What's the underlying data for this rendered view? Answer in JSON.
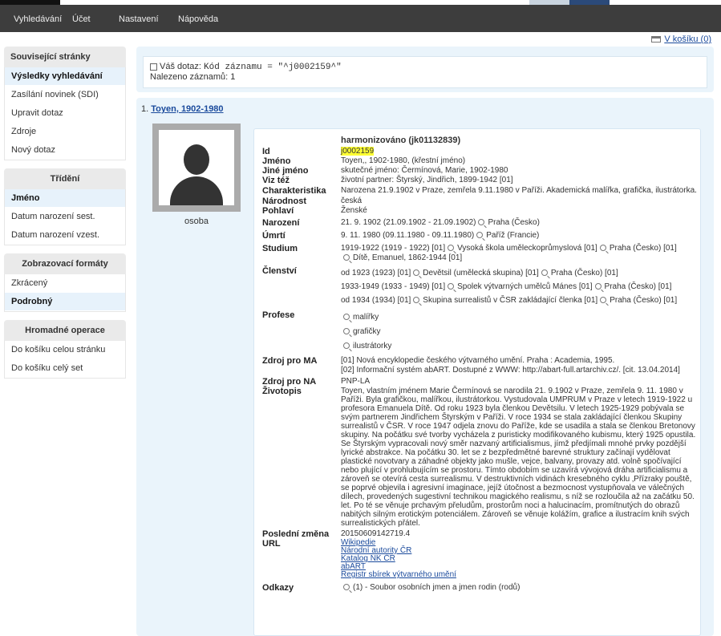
{
  "nav": {
    "items": [
      "Vyhledávání",
      "Účet",
      "Nastavení",
      "Nápověda"
    ]
  },
  "cart": {
    "label": "V košíku (0)"
  },
  "sidebar": {
    "related_title": "Související stránky",
    "related_items": [
      "Výsledky vyhledávání",
      "Zasílání novinek (SDI)",
      "Upravit dotaz",
      "Zdroje",
      "Nový dotaz"
    ],
    "sort_title": "Třídění",
    "sort_items": [
      "Jméno",
      "Datum narození sest.",
      "Datum narození vzest."
    ],
    "format_title": "Zobrazovací formáty",
    "format_items": [
      "Zkrácený",
      "Podrobný"
    ],
    "bulk_title": "Hromadné operace",
    "bulk_items": [
      "Do košíku celou stránku",
      "Do košíku celý set"
    ]
  },
  "query": {
    "prefix": "Váš dotaz:",
    "code": "Kód záznamu = \"^j0002159^\"",
    "count_text": "Nalezeno záznamů: 1"
  },
  "result": {
    "index": "1.",
    "title": "Toyen, 1902-1980",
    "photo_label": "osoba",
    "harmonized": "harmonizováno (jk01132839)",
    "labels": {
      "id": "Id",
      "name": "Jméno",
      "other_name": "Jiné jméno",
      "see_also": "Viz též",
      "characteristics": "Charakteristika",
      "nationality": "Národnost",
      "gender": "Pohlaví",
      "birth": "Narození",
      "death": "Úmrtí",
      "study": "Studium",
      "membership": "Členství",
      "profession": "Profese",
      "source_ma": "Zdroj pro MA",
      "source_na": "Zdroj pro NA",
      "bio": "Životopis",
      "last_change": "Poslední změna",
      "url": "URL",
      "links": "Odkazy"
    },
    "id": "j0002159",
    "name": "Toyen,, 1902-1980, (křestní jméno)",
    "other_name": "skutečné jméno: Čermínová, Marie, 1902-1980",
    "see_also": "životní partner: Štyrský, Jindřich, 1899-1942 [01]",
    "characteristics": "Narozena 21.9.1902 v Praze, zemřela 9.11.1980 v Paříži. Akademická malířka, grafička, ilustrátorka.",
    "nationality": "česká",
    "gender": "Ženské",
    "birth_a": "21. 9. 1902 (21.09.1902 - 21.09.1902)",
    "birth_b": "Praha (Česko)",
    "death_a": "9. 11. 1980 (09.11.1980 - 09.11.1980)",
    "death_b": "Paříž (Francie)",
    "study_1a": "1919-1922 (1919 - 1922) [01]",
    "study_1b": "Vysoká škola uměleckoprůmyslová [01]",
    "study_1c": "Praha (Česko) [01]",
    "study_2": "Dítě, Emanuel, 1862-1944 [01]",
    "member_1a": "od 1923 (1923) [01]",
    "member_1b": "Devětsil (umělecká skupina) [01]",
    "member_1c": "Praha (Česko) [01]",
    "member_2a": "1933-1949 (1933 - 1949) [01]",
    "member_2b": "Spolek výtvarných umělců Mánes [01]",
    "member_2c": "Praha (Česko) [01]",
    "member_3a": "od 1934 (1934) [01]",
    "member_3b": "Skupina surrealistů v ČSR zakládající členka [01]",
    "member_3c": "Praha (Česko) [01]",
    "professions": [
      "malířky",
      "grafičky",
      "ilustrátorky"
    ],
    "source_ma_1": "[01] Nová encyklopedie českého výtvarného umění. Praha : Academia, 1995.",
    "source_ma_2": "[02] Informační systém abART. Dostupné z WWW: http://abart-full.artarchiv.cz/. [cit. 13.04.2014]",
    "source_na": "PNP-LA",
    "bio": "Toyen, vlastním jménem Marie Čermínová se narodila 21. 9.1902 v Praze, zemřela 9. 11. 1980 v Paříži. Byla grafičkou, malířkou, ilustrátorkou. Vystudovala UMPRUM v Praze v letech 1919-1922 u profesora Emanuela Dítě. Od roku 1923 byla členkou Devětsilu. V letech 1925-1929 pobývala se svým partnerem Jindřichem Štyrským v Paříži. V roce 1934 se stala zakládající členkou Skupiny surrealistů v ČSR. V roce 1947 odjela znovu do Paříže, kde se usadila a stala se členkou Bretonovy skupiny. Na počátku své tvorby vycházela z puristicky modifikovaného kubismu, který 1925 opustila. Se Štyrským vypracovali nový směr nazvaný artificialismus, jímž předjímali mnohé prvky pozdější lyrické abstrakce. Na počátku 30. let se z bezpředmětné barevné struktury začínají vydělovat plastické novotvary a záhadné objekty jako mušle, vejce, balvany, provazy atd. volně spočívající nebo plující v prohlubujícím se prostoru. Tímto obdobím se uzavírá vývojová dráha artificialismu a zároveň se otevírá cesta surrealismu. V destruktivních vidinách kresebného cyklu ‚Přízraky pouště, se poprvé objevila i agresivní imaginace, jejíž útočnost a bezmocnost vystupňovala ve válečných dílech, provedených sugestivní technikou magického realismu, s níž se rozloučila až na začátku 50. let. Po té se věnuje prchavým přeludům, prostorům noci a halucinacím, promítnutých do obrazů nabitých silným erotickým potenciálem. Zároveň se věnuje kolážím, grafice a ilustracím knih svých surrealistických přátel.",
    "last_change": "20150609142719.4",
    "urls": [
      "Wikipedie",
      "Národní autority ČR",
      "Katalog NK ČR",
      "abART",
      "Registr sbírek výtvarného umění"
    ],
    "links": "(1) - Soubor osobních jmen a jmen rodin (rodů)"
  }
}
